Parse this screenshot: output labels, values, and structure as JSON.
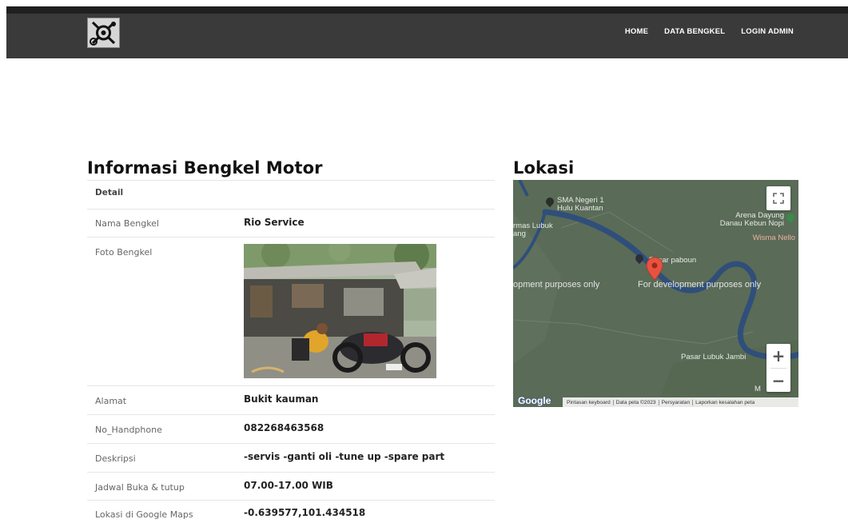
{
  "nav": {
    "links": [
      "HOME",
      "DATA BENGKEL",
      "LOGIN ADMIN"
    ]
  },
  "info": {
    "title": "Informasi Bengkel Motor",
    "detail_header": "Detail",
    "rows": [
      {
        "label": "Nama Bengkel",
        "value": "Rio Service"
      },
      {
        "label": "Foto Bengkel",
        "value": ""
      },
      {
        "label": "Alamat",
        "value": "Bukit kauman"
      },
      {
        "label": "No_Handphone",
        "value": "082268463568"
      },
      {
        "label": "Deskripsi",
        "value": "-servis -ganti oli -tune up -spare part"
      },
      {
        "label": "Jadwal Buka & tutup",
        "value": "07.00-17.00 WIB"
      },
      {
        "label": "Lokasi di Google Maps",
        "value": "-0.639577,101.434518"
      }
    ]
  },
  "map": {
    "title": "Lokasi",
    "labels": {
      "school": "SMA Negeri 1\nHulu Kuantan",
      "arena": "Arena Dayung\nDanau Kebun Nopi",
      "wisma": "Wisma Nello",
      "lubuk_left": "rmas Lubuk\nang",
      "pasar_paboun": "Pasar paboun",
      "dev_left": "opment purposes only",
      "dev_right": "For development purposes only",
      "pasar_lubuk": "Pasar Lubuk Jambi",
      "corner": "M"
    },
    "google_logo": "Google",
    "footer": [
      "Pintasan keyboard",
      "Data peta ©2023",
      "Persyaratan",
      "Laporkan kesalahan peta"
    ],
    "colors": {
      "land": "#5a6b58",
      "river": "#2f4f7a",
      "pin": "#e8533f"
    }
  }
}
